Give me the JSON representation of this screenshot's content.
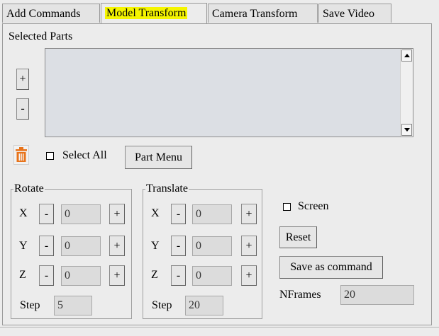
{
  "tabs": [
    {
      "label": "Add Commands",
      "active": false
    },
    {
      "label": "Model Transform",
      "active": true
    },
    {
      "label": "Camera Transform",
      "active": false
    },
    {
      "label": "Save Video",
      "active": false
    }
  ],
  "selected_parts": {
    "label": "Selected Parts",
    "add_label": "+",
    "remove_label": "-"
  },
  "select_all_label": "Select All",
  "part_menu_label": "Part Menu",
  "rotate": {
    "title": "Rotate",
    "rows": [
      {
        "axis": "X",
        "minus": "-",
        "value": "0",
        "plus": "+"
      },
      {
        "axis": "Y",
        "minus": "-",
        "value": "0",
        "plus": "+"
      },
      {
        "axis": "Z",
        "minus": "-",
        "value": "0",
        "plus": "+"
      }
    ],
    "step_label": "Step",
    "step_value": "5"
  },
  "translate": {
    "title": "Translate",
    "rows": [
      {
        "axis": "X",
        "minus": "-",
        "value": "0",
        "plus": "+"
      },
      {
        "axis": "Y",
        "minus": "-",
        "value": "0",
        "plus": "+"
      },
      {
        "axis": "Z",
        "minus": "-",
        "value": "0",
        "plus": "+"
      }
    ],
    "step_label": "Step",
    "step_value": "20"
  },
  "screen_label": "Screen",
  "reset_label": "Reset",
  "save_command_label": "Save as command",
  "nframes_label": "NFrames",
  "nframes_value": "20",
  "colors": {
    "tab_highlight": "#f5f500",
    "trash_icon": "#e8731a"
  },
  "icons": [
    "trash-icon",
    "scroll-up-arrow-icon",
    "scroll-down-arrow-icon",
    "checkbox-icon"
  ]
}
